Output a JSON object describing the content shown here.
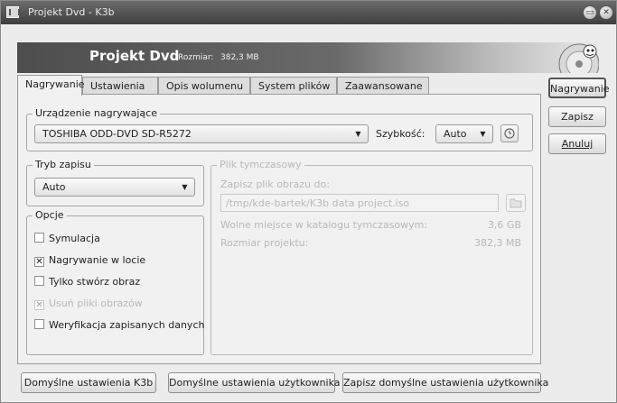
{
  "window": {
    "title": "Projekt Dvd - K3b"
  },
  "banner": {
    "project_title": "Projekt Dvd",
    "size_label": "Rozmiar:",
    "size_value": "382,3 MB"
  },
  "tabs": [
    {
      "label": "Nagrywanie",
      "active": true
    },
    {
      "label": "Ustawienia",
      "active": false
    },
    {
      "label": "Opis wolumenu",
      "active": false
    },
    {
      "label": "System plików",
      "active": false
    },
    {
      "label": "Zaawansowane",
      "active": false
    }
  ],
  "device_group": {
    "title": "Urządzenie nagrywające",
    "device": "TOSHIBA ODD-DVD SD-R5272",
    "speed_label": "Szybkość:",
    "speed_value": "Auto"
  },
  "write_mode": {
    "title": "Tryb zapisu",
    "value": "Auto"
  },
  "options": {
    "title": "Opcje",
    "items": [
      {
        "label": "Symulacja",
        "checked": false,
        "enabled": true
      },
      {
        "label": "Nagrywanie w locie",
        "checked": true,
        "enabled": true
      },
      {
        "label": "Tylko stwórz obraz",
        "checked": false,
        "enabled": true
      },
      {
        "label": "Usuń pliki obrazów",
        "checked": true,
        "enabled": false
      },
      {
        "label": "Weryfikacja zapisanych danych",
        "checked": false,
        "enabled": true
      }
    ]
  },
  "temp_file": {
    "title": "Plik tymczasowy",
    "save_label": "Zapisz plik obrazu do:",
    "path": "/tmp/kde-bartek/K3b data project.iso",
    "free_space_label": "Wolne miejsce w katalogu tymczasowym:",
    "free_space_value": "3,6 GB",
    "project_size_label": "Rozmiar projektu:",
    "project_size_value": "382,3 MB"
  },
  "side_buttons": {
    "burn": "Nagrywanie",
    "save": "Zapisz",
    "cancel": "Anuluj"
  },
  "bottom_buttons": {
    "k3b_defaults": "Domyślne ustawienia K3b",
    "user_defaults": "Domyślne ustawienia użytkownika",
    "save_user_defaults": "Zapisz domyślne ustawienia użytkownika"
  }
}
